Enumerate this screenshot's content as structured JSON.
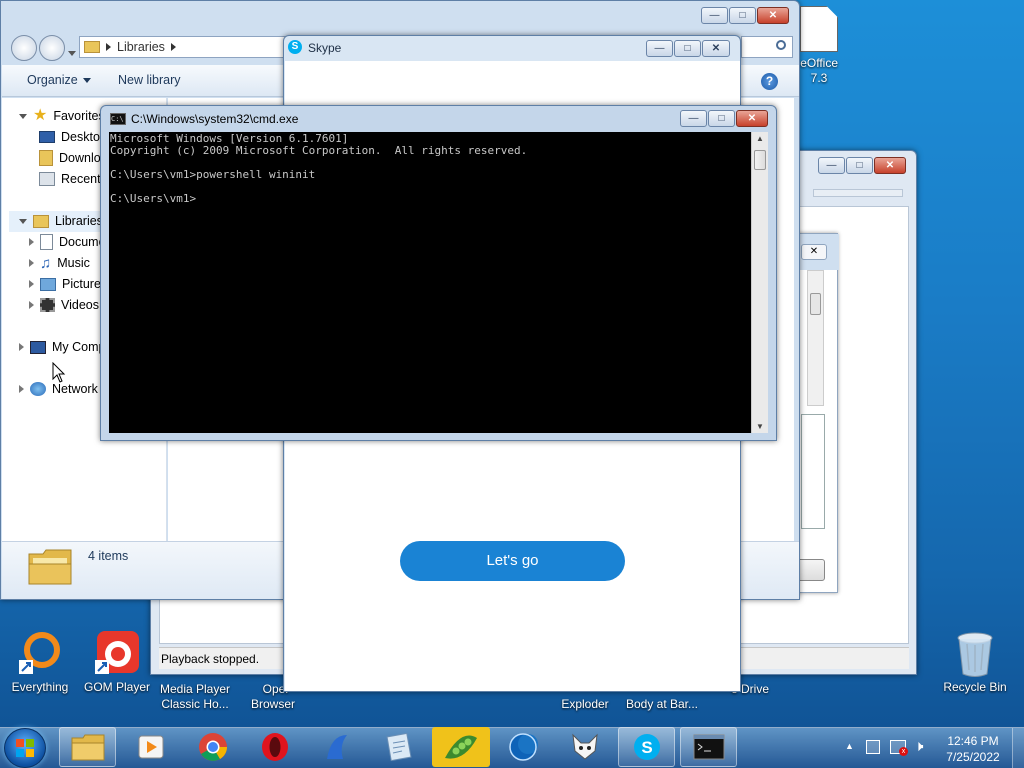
{
  "explorer": {
    "breadcrumb": "Libraries",
    "organize": "Organize",
    "new_library": "New library",
    "favorites": "Favorites",
    "desktop": "Desktop",
    "downloads": "Downlo",
    "recent": "Recent",
    "libraries": "Libraries",
    "documents": "Docume",
    "music": "Music",
    "pictures": "Pictures",
    "videos": "Videos",
    "my_computer": "My Comp",
    "network": "Network",
    "status": "4 items"
  },
  "skype": {
    "title": "Skype",
    "button": "Let's go"
  },
  "cmd": {
    "title": "C:\\Windows\\system32\\cmd.exe",
    "lines": [
      "Microsoft Windows [Version 6.1.7601]",
      "Copyright (c) 2009 Microsoft Corporation.  All rights reserved.",
      "",
      "C:\\Users\\vm1>powershell wininit",
      "",
      "C:\\Users\\vm1>"
    ]
  },
  "player": {
    "status": "Playback stopped."
  },
  "desktop_icons": {
    "libreoffice_line1": "breOffice",
    "libreoffice_line2": "7.3",
    "recycle_bin": "Recycle Bin",
    "everything": "Everything",
    "gom_player": "GOM Player",
    "mpc_line1": "Media Player",
    "mpc_line2": "Classic Ho...",
    "opera_line1": "Oper",
    "opera_line2": "Browser",
    "exploder": "Exploder",
    "body_at_bar": "Body at Bar...",
    "drive": "e Drive"
  },
  "clock": {
    "time": "12:46 PM",
    "date": "7/25/2022"
  },
  "colors": {
    "accent": "#1a83d4",
    "skype_blue": "#00aff0",
    "close_red": "#c7412b"
  }
}
